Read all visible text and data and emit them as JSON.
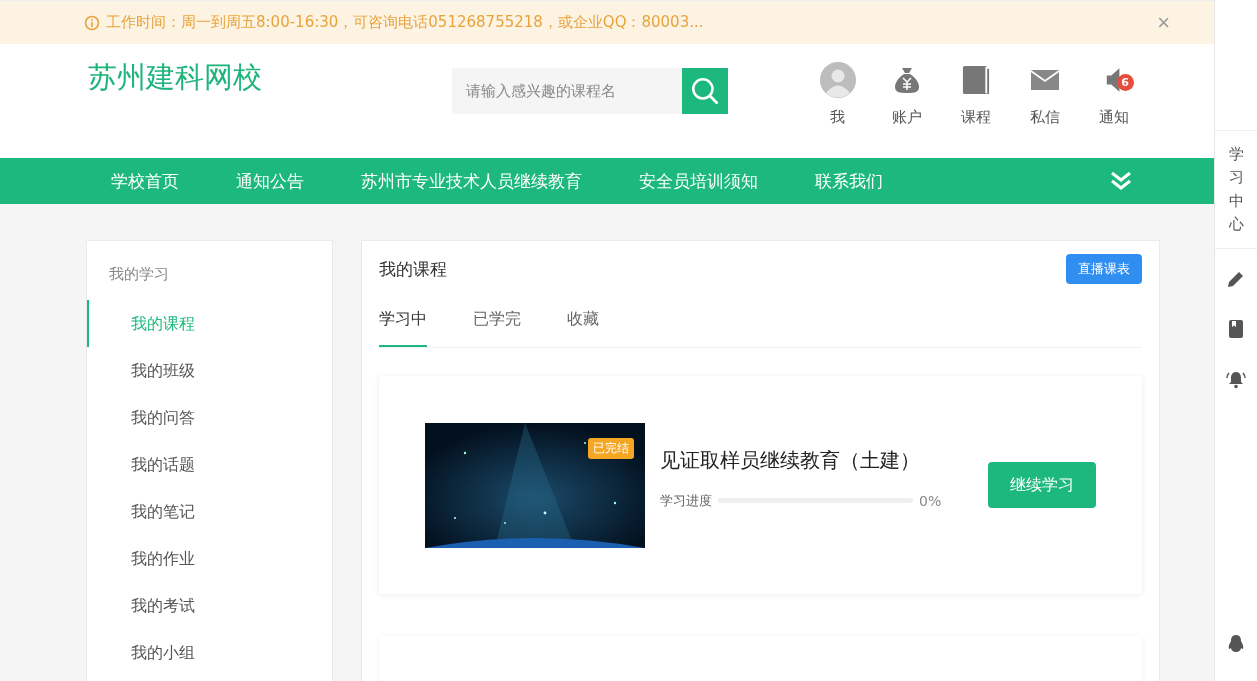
{
  "notice": {
    "text": "工作时间：周一到周五8:00-16:30，可咨询电话051268755218，或企业QQ：80003...",
    "close": "×"
  },
  "header": {
    "logo": "苏州建科网校",
    "search": {
      "placeholder": "请输入感兴趣的课程名"
    },
    "user_menu": [
      {
        "kind": "avatar",
        "label": "我"
      },
      {
        "kind": "account",
        "label": "账户"
      },
      {
        "kind": "course",
        "label": "课程"
      },
      {
        "kind": "message",
        "label": "私信"
      },
      {
        "kind": "notice",
        "label": "通知",
        "badge": "6"
      }
    ]
  },
  "nav": {
    "items": [
      "学校首页",
      "通知公告",
      "苏州市专业技术人员继续教育",
      "安全员培训须知",
      "联系我们"
    ]
  },
  "sidebar": {
    "title": "我的学习",
    "items": [
      {
        "label": "我的课程",
        "selected": true
      },
      {
        "label": "我的班级",
        "selected": false
      },
      {
        "label": "我的问答",
        "selected": false
      },
      {
        "label": "我的话题",
        "selected": false
      },
      {
        "label": "我的笔记",
        "selected": false
      },
      {
        "label": "我的作业",
        "selected": false
      },
      {
        "label": "我的考试",
        "selected": false
      },
      {
        "label": "我的小组",
        "selected": false
      }
    ]
  },
  "panel": {
    "title": "我的课程",
    "action": "直播课表",
    "tabs": [
      {
        "label": "学习中",
        "selected": true
      },
      {
        "label": "已学完",
        "selected": false
      },
      {
        "label": "收藏",
        "selected": false
      }
    ],
    "courses": [
      {
        "badge": "已完结",
        "title": "见证取样员继续教育（土建）",
        "progress_label": "学习进度",
        "level": 0,
        "reading": "0%",
        "button": "继续学习"
      }
    ]
  },
  "rail": {
    "label": "学习中心",
    "tools": [
      {
        "kind": "pencil"
      },
      {
        "kind": "book"
      },
      {
        "kind": "bell"
      }
    ],
    "bottom": {
      "kind": "qq"
    }
  }
}
